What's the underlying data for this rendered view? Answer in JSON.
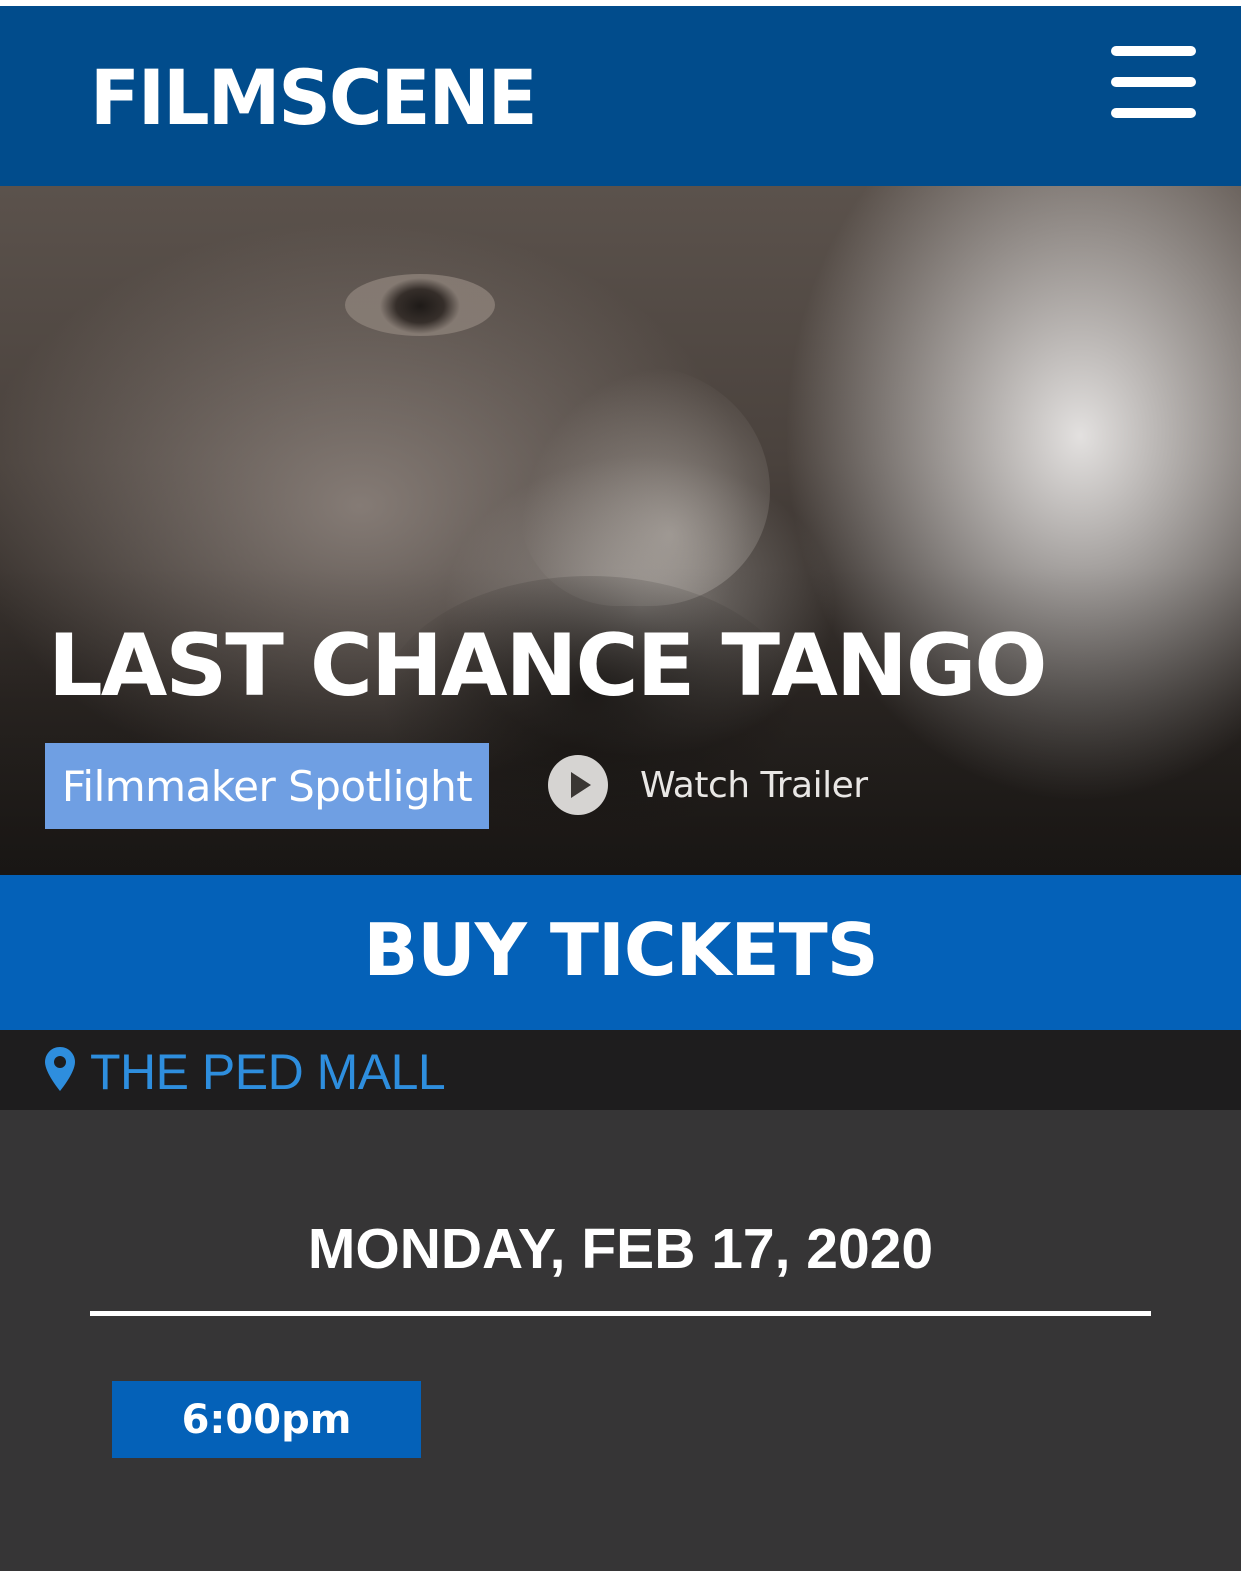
{
  "header": {
    "logo_text": "FILMSCENE",
    "menu_icon": "hamburger-menu-icon",
    "background_color": "#014c8c"
  },
  "hero": {
    "title": "LAST CHANCE TANGO",
    "badge_label": "Filmmaker Spotlight",
    "trailer_icon": "play-icon",
    "trailer_label": "Watch Trailer",
    "badge_color": "#6f9fe3"
  },
  "buy_tickets": {
    "label": "BUY TICKETS",
    "background_color": "#0461b8"
  },
  "location": {
    "icon": "map-pin-icon",
    "name": "THE PED MALL",
    "color": "#2e8ede"
  },
  "showtimes": {
    "date": "MONDAY, FEB 17, 2020",
    "times": [
      "6:00pm"
    ]
  }
}
